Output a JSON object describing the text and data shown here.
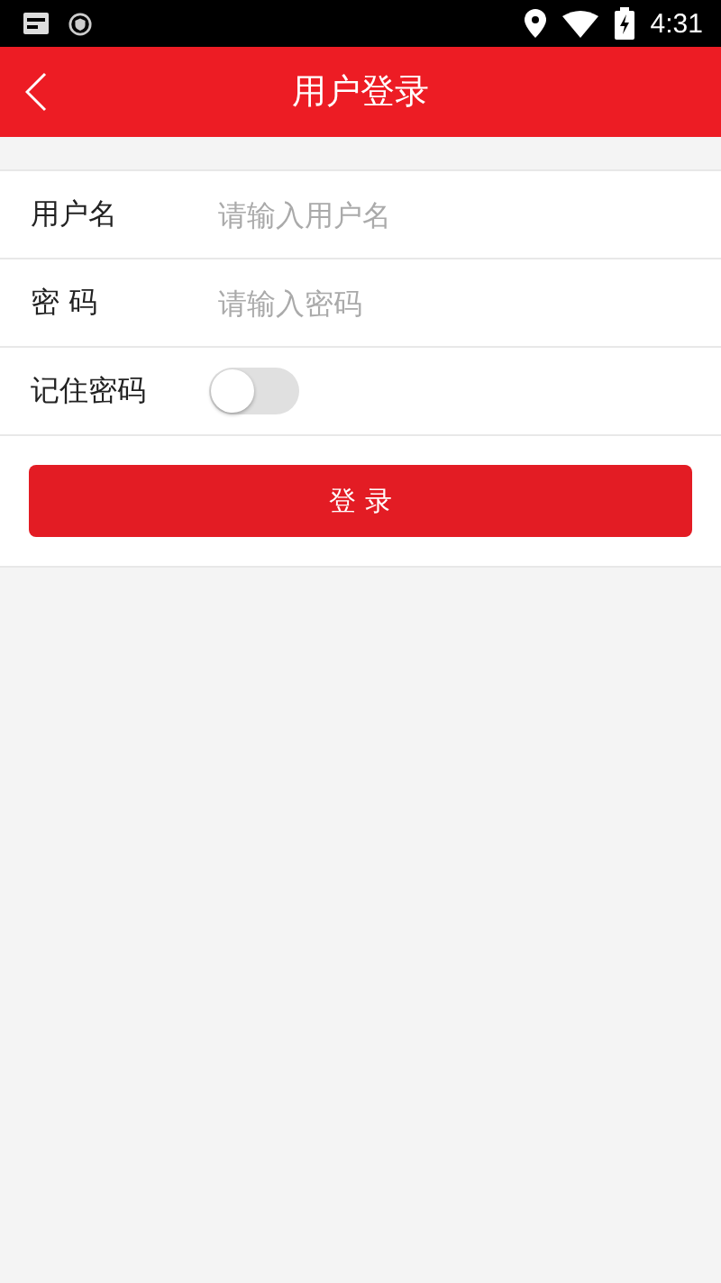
{
  "status_bar": {
    "time": "4:31"
  },
  "header": {
    "title": "用户登录"
  },
  "fields": [
    {
      "label": "用户名",
      "placeholder": "请输入用户名"
    },
    {
      "label": "密 码",
      "placeholder": "请输入密码"
    }
  ],
  "remember": {
    "label": "记住密码",
    "on": false
  },
  "login_button": {
    "label": "登 录"
  }
}
